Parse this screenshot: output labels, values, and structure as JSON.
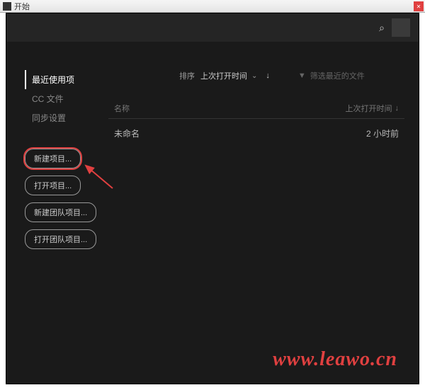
{
  "window": {
    "title": "开始"
  },
  "sidebar": {
    "items": [
      {
        "label": "最近使用项",
        "active": true
      },
      {
        "label": "CC 文件",
        "active": false
      },
      {
        "label": "同步设置",
        "active": false
      }
    ],
    "buttons": [
      {
        "label": "新建项目...",
        "highlighted": true
      },
      {
        "label": "打开项目...",
        "highlighted": false
      },
      {
        "label": "新建团队项目...",
        "highlighted": false
      },
      {
        "label": "打开团队项目...",
        "highlighted": false
      }
    ]
  },
  "sort": {
    "label": "排序",
    "value": "上次打开时间"
  },
  "filter": {
    "label": "筛选最近的文件"
  },
  "table": {
    "headers": {
      "name": "名称",
      "time": "上次打开时间"
    },
    "rows": [
      {
        "name": "未命名",
        "time": "2 小时前"
      }
    ]
  },
  "watermark": "www.leawo.cn"
}
